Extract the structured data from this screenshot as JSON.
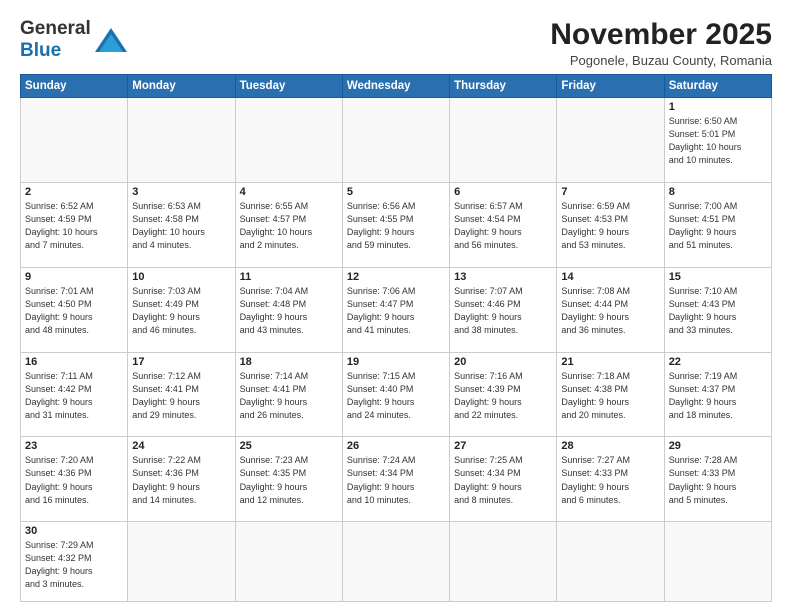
{
  "header": {
    "logo_general": "General",
    "logo_blue": "Blue",
    "month_title": "November 2025",
    "subtitle": "Pogonele, Buzau County, Romania"
  },
  "days_of_week": [
    "Sunday",
    "Monday",
    "Tuesday",
    "Wednesday",
    "Thursday",
    "Friday",
    "Saturday"
  ],
  "weeks": [
    [
      {
        "day": "",
        "info": ""
      },
      {
        "day": "",
        "info": ""
      },
      {
        "day": "",
        "info": ""
      },
      {
        "day": "",
        "info": ""
      },
      {
        "day": "",
        "info": ""
      },
      {
        "day": "",
        "info": ""
      },
      {
        "day": "1",
        "info": "Sunrise: 6:50 AM\nSunset: 5:01 PM\nDaylight: 10 hours\nand 10 minutes."
      }
    ],
    [
      {
        "day": "2",
        "info": "Sunrise: 6:52 AM\nSunset: 4:59 PM\nDaylight: 10 hours\nand 7 minutes."
      },
      {
        "day": "3",
        "info": "Sunrise: 6:53 AM\nSunset: 4:58 PM\nDaylight: 10 hours\nand 4 minutes."
      },
      {
        "day": "4",
        "info": "Sunrise: 6:55 AM\nSunset: 4:57 PM\nDaylight: 10 hours\nand 2 minutes."
      },
      {
        "day": "5",
        "info": "Sunrise: 6:56 AM\nSunset: 4:55 PM\nDaylight: 9 hours\nand 59 minutes."
      },
      {
        "day": "6",
        "info": "Sunrise: 6:57 AM\nSunset: 4:54 PM\nDaylight: 9 hours\nand 56 minutes."
      },
      {
        "day": "7",
        "info": "Sunrise: 6:59 AM\nSunset: 4:53 PM\nDaylight: 9 hours\nand 53 minutes."
      },
      {
        "day": "8",
        "info": "Sunrise: 7:00 AM\nSunset: 4:51 PM\nDaylight: 9 hours\nand 51 minutes."
      }
    ],
    [
      {
        "day": "9",
        "info": "Sunrise: 7:01 AM\nSunset: 4:50 PM\nDaylight: 9 hours\nand 48 minutes."
      },
      {
        "day": "10",
        "info": "Sunrise: 7:03 AM\nSunset: 4:49 PM\nDaylight: 9 hours\nand 46 minutes."
      },
      {
        "day": "11",
        "info": "Sunrise: 7:04 AM\nSunset: 4:48 PM\nDaylight: 9 hours\nand 43 minutes."
      },
      {
        "day": "12",
        "info": "Sunrise: 7:06 AM\nSunset: 4:47 PM\nDaylight: 9 hours\nand 41 minutes."
      },
      {
        "day": "13",
        "info": "Sunrise: 7:07 AM\nSunset: 4:46 PM\nDaylight: 9 hours\nand 38 minutes."
      },
      {
        "day": "14",
        "info": "Sunrise: 7:08 AM\nSunset: 4:44 PM\nDaylight: 9 hours\nand 36 minutes."
      },
      {
        "day": "15",
        "info": "Sunrise: 7:10 AM\nSunset: 4:43 PM\nDaylight: 9 hours\nand 33 minutes."
      }
    ],
    [
      {
        "day": "16",
        "info": "Sunrise: 7:11 AM\nSunset: 4:42 PM\nDaylight: 9 hours\nand 31 minutes."
      },
      {
        "day": "17",
        "info": "Sunrise: 7:12 AM\nSunset: 4:41 PM\nDaylight: 9 hours\nand 29 minutes."
      },
      {
        "day": "18",
        "info": "Sunrise: 7:14 AM\nSunset: 4:41 PM\nDaylight: 9 hours\nand 26 minutes."
      },
      {
        "day": "19",
        "info": "Sunrise: 7:15 AM\nSunset: 4:40 PM\nDaylight: 9 hours\nand 24 minutes."
      },
      {
        "day": "20",
        "info": "Sunrise: 7:16 AM\nSunset: 4:39 PM\nDaylight: 9 hours\nand 22 minutes."
      },
      {
        "day": "21",
        "info": "Sunrise: 7:18 AM\nSunset: 4:38 PM\nDaylight: 9 hours\nand 20 minutes."
      },
      {
        "day": "22",
        "info": "Sunrise: 7:19 AM\nSunset: 4:37 PM\nDaylight: 9 hours\nand 18 minutes."
      }
    ],
    [
      {
        "day": "23",
        "info": "Sunrise: 7:20 AM\nSunset: 4:36 PM\nDaylight: 9 hours\nand 16 minutes."
      },
      {
        "day": "24",
        "info": "Sunrise: 7:22 AM\nSunset: 4:36 PM\nDaylight: 9 hours\nand 14 minutes."
      },
      {
        "day": "25",
        "info": "Sunrise: 7:23 AM\nSunset: 4:35 PM\nDaylight: 9 hours\nand 12 minutes."
      },
      {
        "day": "26",
        "info": "Sunrise: 7:24 AM\nSunset: 4:34 PM\nDaylight: 9 hours\nand 10 minutes."
      },
      {
        "day": "27",
        "info": "Sunrise: 7:25 AM\nSunset: 4:34 PM\nDaylight: 9 hours\nand 8 minutes."
      },
      {
        "day": "28",
        "info": "Sunrise: 7:27 AM\nSunset: 4:33 PM\nDaylight: 9 hours\nand 6 minutes."
      },
      {
        "day": "29",
        "info": "Sunrise: 7:28 AM\nSunset: 4:33 PM\nDaylight: 9 hours\nand 5 minutes."
      }
    ],
    [
      {
        "day": "30",
        "info": "Sunrise: 7:29 AM\nSunset: 4:32 PM\nDaylight: 9 hours\nand 3 minutes."
      },
      {
        "day": "",
        "info": ""
      },
      {
        "day": "",
        "info": ""
      },
      {
        "day": "",
        "info": ""
      },
      {
        "day": "",
        "info": ""
      },
      {
        "day": "",
        "info": ""
      },
      {
        "day": "",
        "info": ""
      }
    ]
  ]
}
